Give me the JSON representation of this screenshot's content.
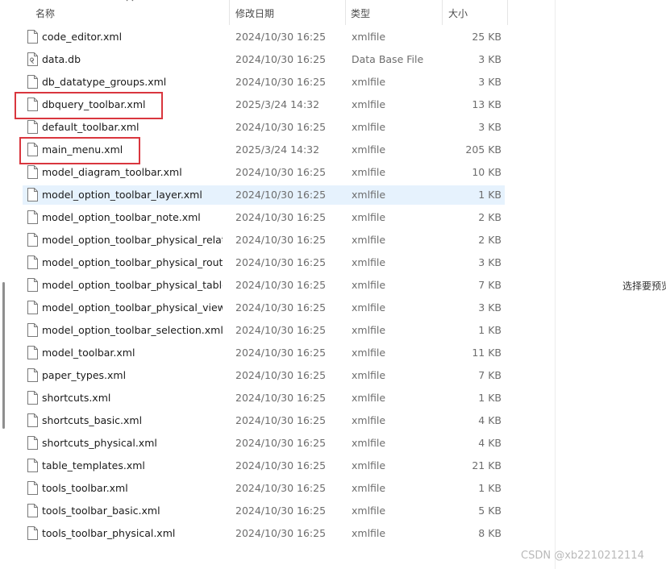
{
  "columns": {
    "name": "名称",
    "date": "修改日期",
    "type": "类型",
    "size": "大小"
  },
  "files": [
    {
      "name": "code_editor.xml",
      "date": "2024/10/30 16:25",
      "type": "xmlfile",
      "size": "25 KB",
      "icon": "file-icon"
    },
    {
      "name": "data.db",
      "date": "2024/10/30 16:25",
      "type": "Data Base File",
      "size": "3 KB",
      "icon": "database-file-icon"
    },
    {
      "name": "db_datatype_groups.xml",
      "date": "2024/10/30 16:25",
      "type": "xmlfile",
      "size": "3 KB",
      "icon": "file-icon"
    },
    {
      "name": "dbquery_toolbar.xml",
      "date": "2025/3/24 14:32",
      "type": "xmlfile",
      "size": "13 KB",
      "icon": "file-icon"
    },
    {
      "name": "default_toolbar.xml",
      "date": "2024/10/30 16:25",
      "type": "xmlfile",
      "size": "3 KB",
      "icon": "file-icon"
    },
    {
      "name": "main_menu.xml",
      "date": "2025/3/24 14:32",
      "type": "xmlfile",
      "size": "205 KB",
      "icon": "file-icon"
    },
    {
      "name": "model_diagram_toolbar.xml",
      "date": "2024/10/30 16:25",
      "type": "xmlfile",
      "size": "10 KB",
      "icon": "file-icon"
    },
    {
      "name": "model_option_toolbar_layer.xml",
      "date": "2024/10/30 16:25",
      "type": "xmlfile",
      "size": "1 KB",
      "icon": "file-icon"
    },
    {
      "name": "model_option_toolbar_note.xml",
      "date": "2024/10/30 16:25",
      "type": "xmlfile",
      "size": "2 KB",
      "icon": "file-icon"
    },
    {
      "name": "model_option_toolbar_physical_relati...",
      "date": "2024/10/30 16:25",
      "type": "xmlfile",
      "size": "2 KB",
      "icon": "file-icon"
    },
    {
      "name": "model_option_toolbar_physical_routi...",
      "date": "2024/10/30 16:25",
      "type": "xmlfile",
      "size": "3 KB",
      "icon": "file-icon"
    },
    {
      "name": "model_option_toolbar_physical_table....",
      "date": "2024/10/30 16:25",
      "type": "xmlfile",
      "size": "7 KB",
      "icon": "file-icon"
    },
    {
      "name": "model_option_toolbar_physical_view....",
      "date": "2024/10/30 16:25",
      "type": "xmlfile",
      "size": "3 KB",
      "icon": "file-icon"
    },
    {
      "name": "model_option_toolbar_selection.xml",
      "date": "2024/10/30 16:25",
      "type": "xmlfile",
      "size": "1 KB",
      "icon": "file-icon"
    },
    {
      "name": "model_toolbar.xml",
      "date": "2024/10/30 16:25",
      "type": "xmlfile",
      "size": "11 KB",
      "icon": "file-icon"
    },
    {
      "name": "paper_types.xml",
      "date": "2024/10/30 16:25",
      "type": "xmlfile",
      "size": "7 KB",
      "icon": "file-icon"
    },
    {
      "name": "shortcuts.xml",
      "date": "2024/10/30 16:25",
      "type": "xmlfile",
      "size": "1 KB",
      "icon": "file-icon"
    },
    {
      "name": "shortcuts_basic.xml",
      "date": "2024/10/30 16:25",
      "type": "xmlfile",
      "size": "4 KB",
      "icon": "file-icon"
    },
    {
      "name": "shortcuts_physical.xml",
      "date": "2024/10/30 16:25",
      "type": "xmlfile",
      "size": "4 KB",
      "icon": "file-icon"
    },
    {
      "name": "table_templates.xml",
      "date": "2024/10/30 16:25",
      "type": "xmlfile",
      "size": "21 KB",
      "icon": "file-icon"
    },
    {
      "name": "tools_toolbar.xml",
      "date": "2024/10/30 16:25",
      "type": "xmlfile",
      "size": "1 KB",
      "icon": "file-icon"
    },
    {
      "name": "tools_toolbar_basic.xml",
      "date": "2024/10/30 16:25",
      "type": "xmlfile",
      "size": "5 KB",
      "icon": "file-icon"
    },
    {
      "name": "tools_toolbar_physical.xml",
      "date": "2024/10/30 16:25",
      "type": "xmlfile",
      "size": "8 KB",
      "icon": "file-icon"
    }
  ],
  "selected_index": 7,
  "highlighted_indices": [
    3,
    5
  ],
  "highlight_color": "#d9363e",
  "selection_color": "#e6f2fd",
  "preview_hint": "选择要预览",
  "watermark": "CSDN @xb2210212114"
}
